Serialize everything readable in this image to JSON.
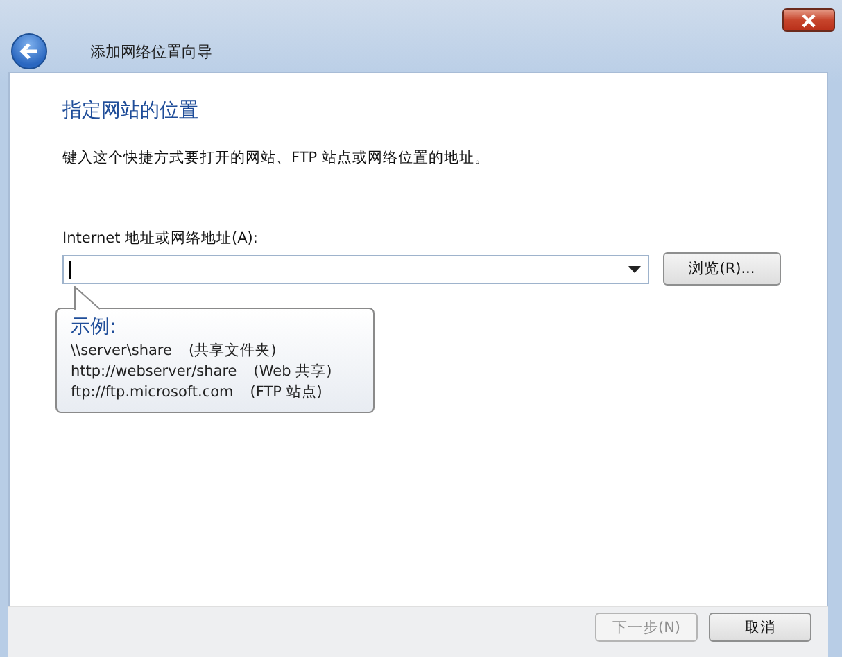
{
  "window": {
    "title": "添加网络位置向导"
  },
  "heading": "指定网站的位置",
  "description": "键入这个快捷方式要打开的网站、FTP 站点或网络位置的地址。",
  "address": {
    "label": "Internet 地址或网络地址(A):"
  },
  "browse_button": "浏览(R)...",
  "tooltip": {
    "title": "示例:",
    "examples": [
      {
        "path": "\\\\server\\share",
        "note": "(共享文件夹)"
      },
      {
        "path": "http://webserver/share",
        "note": "(Web 共享)"
      },
      {
        "path": "ftp://ftp.microsoft.com",
        "note": "(FTP 站点)"
      }
    ]
  },
  "buttons": [
    {
      "label": "下一步(N)",
      "disabled": true
    },
    {
      "label": "取消",
      "disabled": false
    }
  ]
}
